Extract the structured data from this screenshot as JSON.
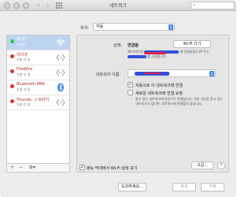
{
  "window": {
    "title": "네트워크",
    "search_glyph": "⌕"
  },
  "location": {
    "label": "위치:",
    "value": "자동"
  },
  "services": [
    {
      "name": "Wi-Fi",
      "status": "연결됨",
      "dot": "green",
      "icon": "wifi-icon"
    },
    {
      "name": "이더넷",
      "status": "연결 안 됨",
      "dot": "red",
      "icon": "ethernet-icon"
    },
    {
      "name": "FireWire",
      "status": "연결 안 됨",
      "dot": "red",
      "icon": "firewire-icon"
    },
    {
      "name": "Bluetooth PAN",
      "status": "연결 안 됨",
      "dot": "red",
      "icon": "bluetooth-icon"
    },
    {
      "name": "Thunde…t 브리지",
      "status": "연결 안 됨",
      "dot": "red",
      "icon": "thunderbolt-icon"
    }
  ],
  "sidebar_buttons": {
    "add": "+",
    "remove": "−",
    "gear": "⚙▾"
  },
  "detail": {
    "status_label": "상태:",
    "status_value": "연결됨",
    "wifi_off_button": "Wi-Fi 끄기",
    "status_desc_prefix": "Wi-Fi이(가)",
    "status_desc_mid": "에 연결되었고 IP 주소",
    "status_desc_end": "를 사용합니다.",
    "network_name_label": "네트워크 이름:",
    "auto_join_label": "자동으로 이 네트워크에 연결",
    "auto_join_checked": true,
    "ask_join_label": "새로운 네트워크에 연결 요청",
    "ask_join_checked": false,
    "ask_join_desc": "알고 있는 네트워크에 자동으로 연결됩니다. 사용 가능한 알고 있는 네트워크가 없다면, 네트워크에 연결할지 묻습니다.",
    "show_status_label": "메뉴 막대에서 Wi-Fi 상태 보기",
    "show_status_checked": true,
    "advanced_button": "고급...",
    "help_button": "?"
  },
  "footer": {
    "assist": "도와주세요...",
    "revert": "복귀",
    "apply": "적용"
  },
  "colors": {
    "selected_row": "#bcd4f0",
    "connected": "#2ecc40",
    "disconnected": "#e0322a",
    "accent": "#3b82f6"
  }
}
